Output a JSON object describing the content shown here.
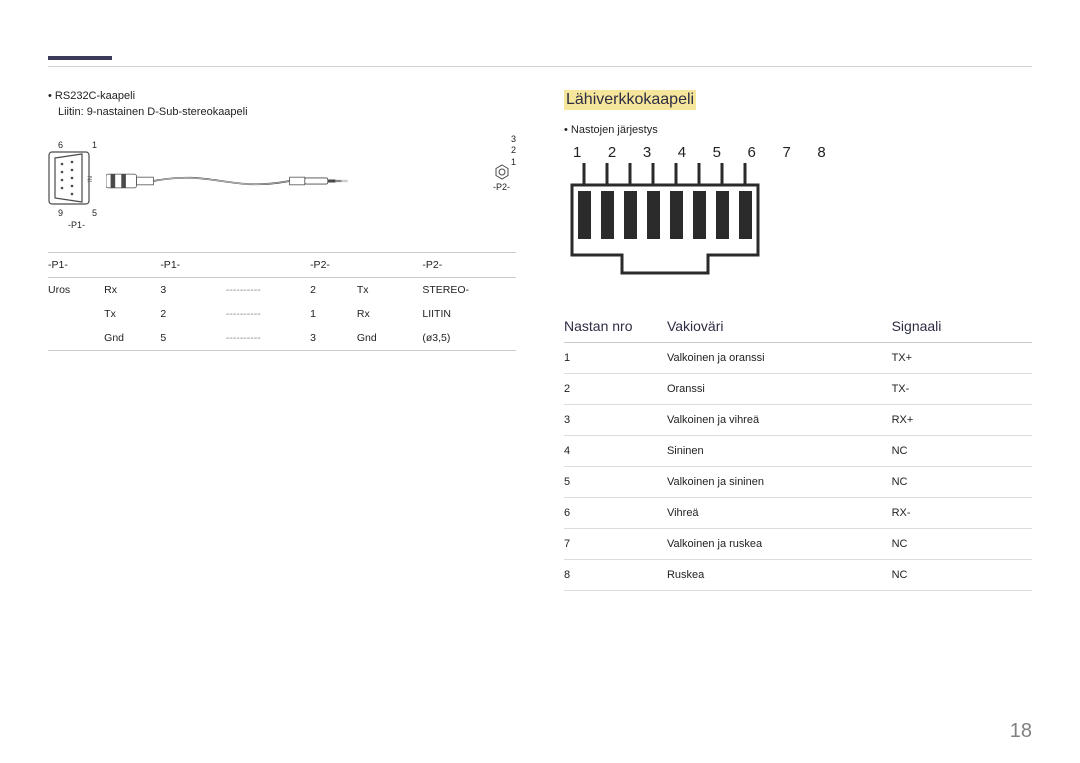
{
  "page_number": "18",
  "left": {
    "cable_type": "RS232C-kaapeli",
    "connector_desc": "Liitin: 9-nastainen D-Sub-stereokaapeli",
    "fig": {
      "n6": "6",
      "n1": "1",
      "n9": "9",
      "n5": "5",
      "p1": "-P1-",
      "r3": "3",
      "r2": "2",
      "r1": "1",
      "p2": "-P2-"
    },
    "table": {
      "headers": [
        "-P1-",
        "-P1-",
        "",
        "-P2-",
        "",
        "-P2-"
      ],
      "lead": "Uros",
      "rows": [
        {
          "a": "Rx",
          "b": "3",
          "c": "----------",
          "d": "2",
          "e": "Tx",
          "f": "STEREO-"
        },
        {
          "a": "Tx",
          "b": "2",
          "c": "----------",
          "d": "1",
          "e": "Rx",
          "f": "LIITIN"
        },
        {
          "a": "Gnd",
          "b": "5",
          "c": "----------",
          "d": "3",
          "e": "Gnd",
          "f": "(ø3,5)"
        }
      ]
    }
  },
  "right": {
    "section_title": "Lähiverkkokaapeli",
    "pin_order_label": "Nastojen järjestys",
    "rj45_numbers": "1 2 3 4 5 6 7 8",
    "table": {
      "headers": {
        "pin": "Nastan nro",
        "color": "Vakioväri",
        "signal": "Signaali"
      },
      "rows": [
        {
          "pin": "1",
          "color": "Valkoinen ja oranssi",
          "signal": "TX+"
        },
        {
          "pin": "2",
          "color": "Oranssi",
          "signal": "TX-"
        },
        {
          "pin": "3",
          "color": "Valkoinen ja vihreä",
          "signal": "RX+"
        },
        {
          "pin": "4",
          "color": "Sininen",
          "signal": "NC"
        },
        {
          "pin": "5",
          "color": "Valkoinen ja sininen",
          "signal": "NC"
        },
        {
          "pin": "6",
          "color": "Vihreä",
          "signal": "RX-"
        },
        {
          "pin": "7",
          "color": "Valkoinen ja ruskea",
          "signal": "NC"
        },
        {
          "pin": "8",
          "color": "Ruskea",
          "signal": "NC"
        }
      ]
    }
  }
}
